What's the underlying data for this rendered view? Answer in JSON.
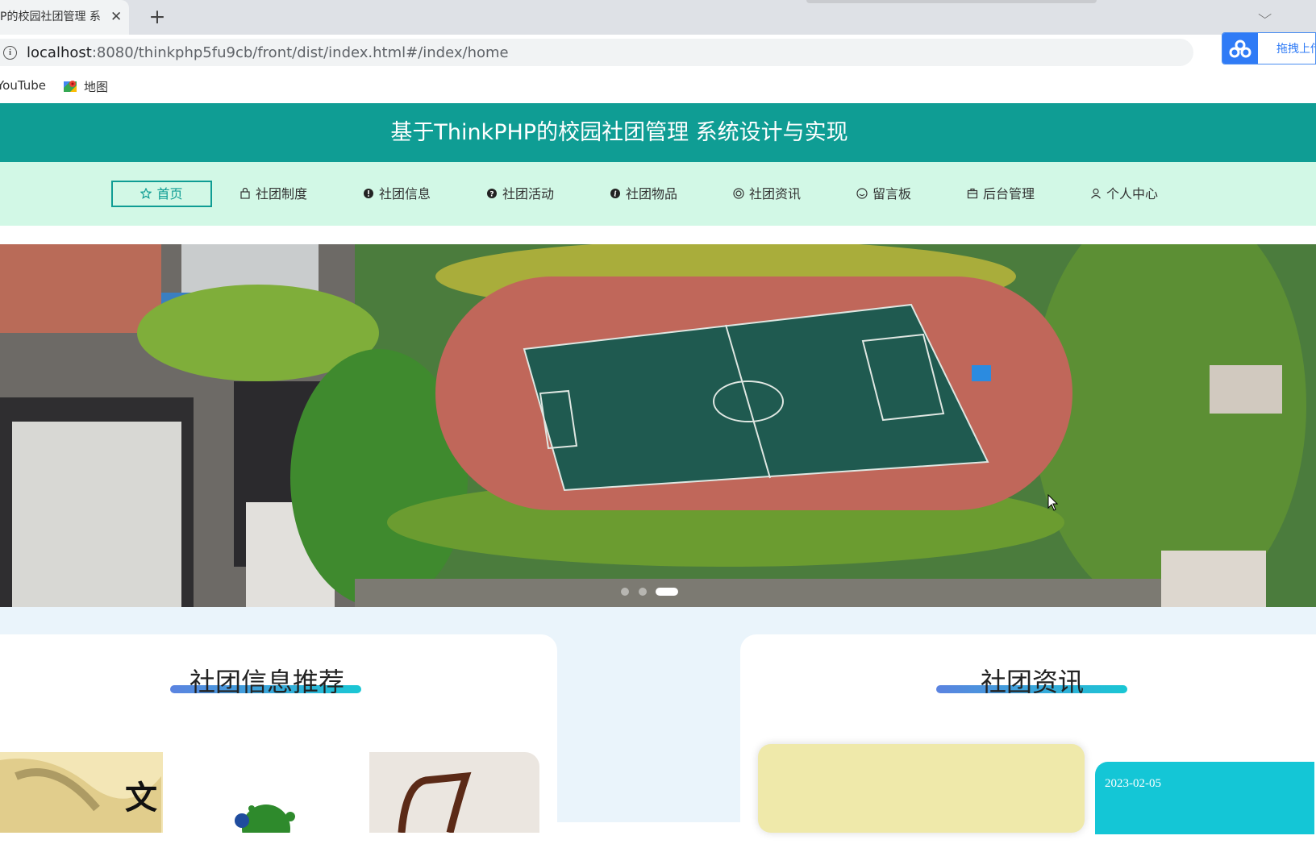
{
  "browser": {
    "tab_title": "P的校园社团管理 系",
    "url_host": "localhost",
    "url_path": ":8080/thinkphp5fu9cb/front/dist/index.html#/index/home",
    "extension_label": "拖拽上传",
    "bookmarks": [
      "YouTube",
      "地图"
    ]
  },
  "header": {
    "title": "基于ThinkPHP的校园社团管理 系统设计与实现"
  },
  "nav": {
    "items": [
      {
        "label": "首页",
        "icon": "star-icon",
        "active": true
      },
      {
        "label": "社团制度",
        "icon": "bag-icon",
        "active": false
      },
      {
        "label": "社团信息",
        "icon": "info-circle-icon",
        "active": false
      },
      {
        "label": "社团活动",
        "icon": "question-circle-icon",
        "active": false
      },
      {
        "label": "社团物品",
        "icon": "info-filled-icon",
        "active": false
      },
      {
        "label": "社团资讯",
        "icon": "target-icon",
        "active": false
      },
      {
        "label": "留言板",
        "icon": "chat-icon",
        "active": false
      },
      {
        "label": "后台管理",
        "icon": "suitcase-icon",
        "active": false
      },
      {
        "label": "个人中心",
        "icon": "user-icon",
        "active": false
      }
    ]
  },
  "carousel": {
    "slide_count": 3,
    "active_index": 2
  },
  "sections": {
    "club_info": {
      "title": "社团信息推荐"
    },
    "club_news": {
      "title": "社团资讯",
      "first_date": "2023-02-05"
    }
  },
  "colors": {
    "header_bg": "#0f9d94",
    "nav_bg": "#d2f8e6",
    "content_bg": "#eaf4fb",
    "accent_teal": "#19c7d4"
  }
}
